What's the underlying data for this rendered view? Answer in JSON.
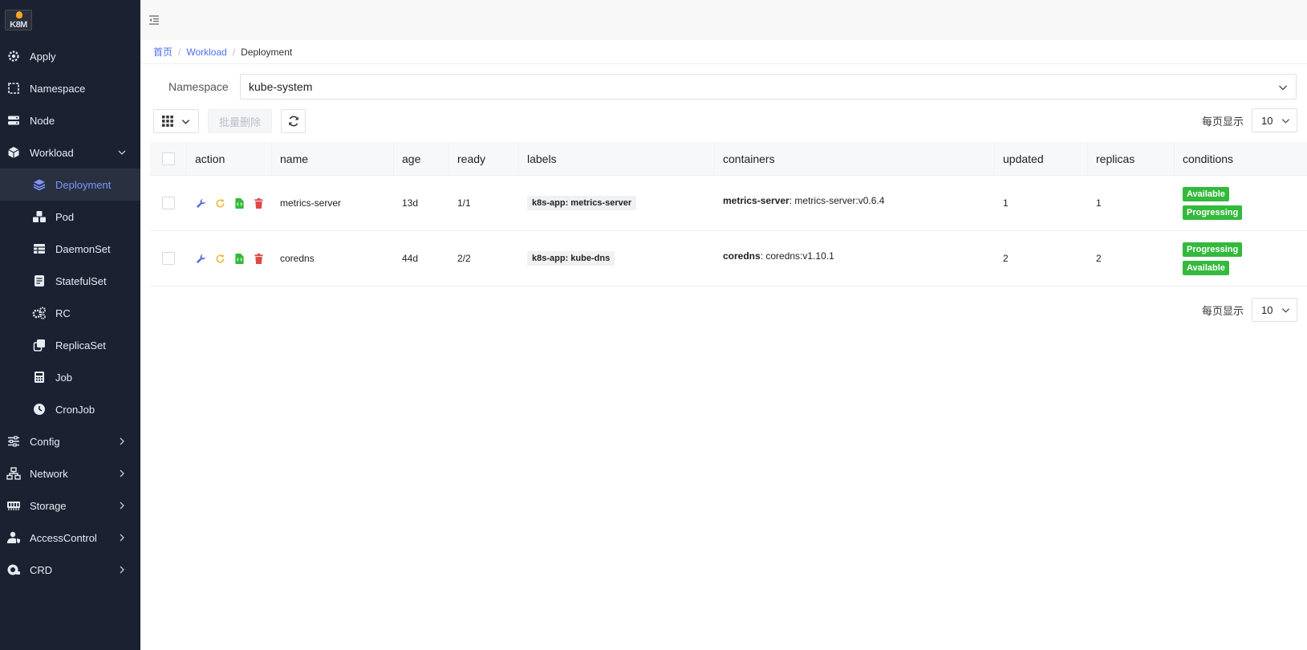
{
  "logo": {
    "text": "K8M"
  },
  "sidebar": {
    "items": [
      {
        "label": "Apply",
        "icon": "gear-icon"
      },
      {
        "label": "Namespace",
        "icon": "namespace-icon"
      },
      {
        "label": "Node",
        "icon": "server-icon"
      },
      {
        "label": "Workload",
        "icon": "cube-icon",
        "expanded": true
      }
    ],
    "workload_children": [
      {
        "label": "Deployment",
        "icon": "layers-icon",
        "active": true
      },
      {
        "label": "Pod",
        "icon": "cubes-icon"
      },
      {
        "label": "DaemonSet",
        "icon": "table-icon"
      },
      {
        "label": "StatefulSet",
        "icon": "file-icon"
      },
      {
        "label": "RC",
        "icon": "cogs-icon"
      },
      {
        "label": "ReplicaSet",
        "icon": "copy-icon"
      },
      {
        "label": "Job",
        "icon": "calculator-icon"
      },
      {
        "label": "CronJob",
        "icon": "clock-icon"
      }
    ],
    "bottom_items": [
      {
        "label": "Config",
        "icon": "sliders-icon"
      },
      {
        "label": "Network",
        "icon": "network-icon"
      },
      {
        "label": "Storage",
        "icon": "memory-icon"
      },
      {
        "label": "AccessControl",
        "icon": "user-shield-icon"
      },
      {
        "label": "CRD",
        "icon": "crd-icon"
      }
    ]
  },
  "breadcrumb": {
    "home": "首页",
    "workload": "Workload",
    "current": "Deployment",
    "separator": "/"
  },
  "namespace": {
    "label": "Namespace",
    "value": "kube-system"
  },
  "toolbar": {
    "batch_delete": "批量删除",
    "per_page_label": "每页显示",
    "per_page_value": "10"
  },
  "table": {
    "columns": [
      "action",
      "name",
      "age",
      "ready",
      "labels",
      "containers",
      "updated",
      "replicas",
      "conditions"
    ],
    "rows": [
      {
        "name": "metrics-server",
        "age": "13d",
        "ready": "1/1",
        "label": "k8s-app: metrics-server",
        "container_name": "metrics-server",
        "container_image": ": metrics-server:v0.6.4",
        "updated": "1",
        "replicas": "1",
        "conditions": [
          "Available",
          "Progressing"
        ]
      },
      {
        "name": "coredns",
        "age": "44d",
        "ready": "2/2",
        "label": "k8s-app: kube-dns",
        "container_name": "coredns",
        "container_image": ": coredns:v1.10.1",
        "updated": "2",
        "replicas": "2",
        "conditions": [
          "Progressing",
          "Available"
        ]
      }
    ]
  },
  "colors": {
    "sidebar_bg": "#1b2130",
    "active_text": "#7e95ff",
    "link": "#4e6ef2",
    "badge_green": "#33b93b",
    "edit_icon": "#5b6ee1",
    "restart_icon": "#f0b429",
    "yaml_icon": "#33b93b",
    "delete_icon": "#e04848"
  }
}
